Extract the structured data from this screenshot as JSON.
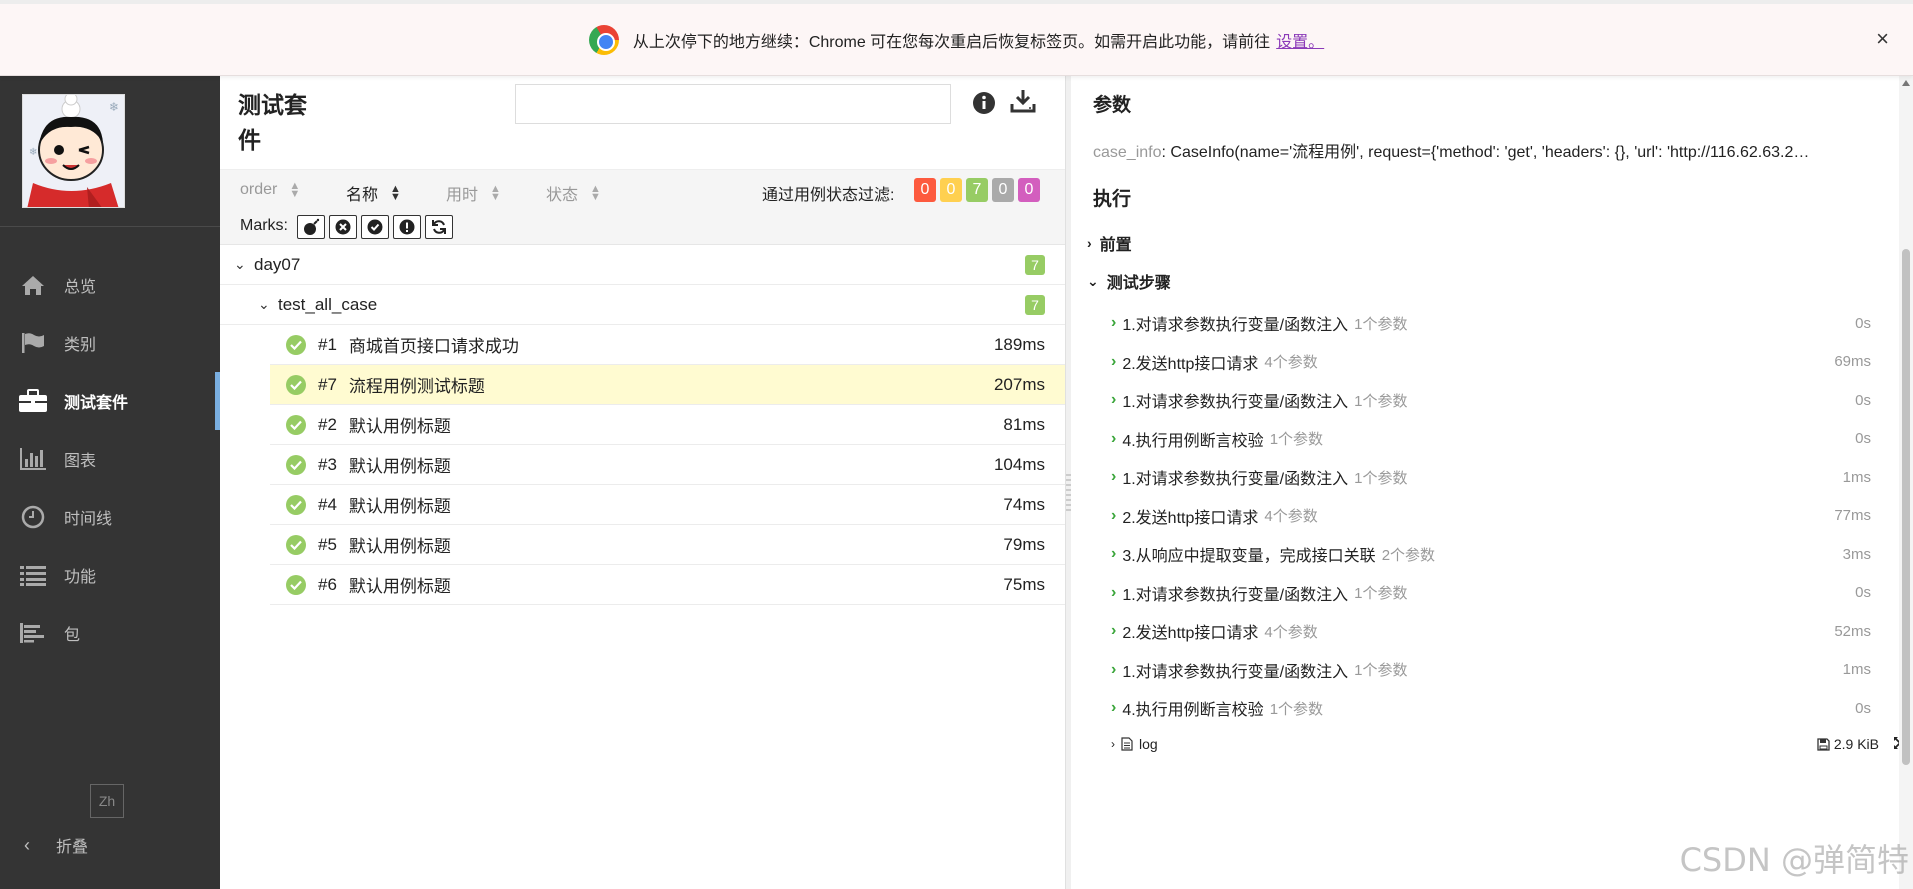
{
  "infobar": {
    "message": "从上次停下的地方继续：Chrome 可在您每次重启后恢复标签页。如需开启此功能，请前往",
    "link": "设置。",
    "close_label": "×"
  },
  "sidebar": {
    "items": [
      {
        "label": "总览",
        "icon": "home-icon"
      },
      {
        "label": "类别",
        "icon": "flag-icon"
      },
      {
        "label": "测试套件",
        "icon": "briefcase-icon",
        "active": true
      },
      {
        "label": "图表",
        "icon": "bar-chart-icon"
      },
      {
        "label": "时间线",
        "icon": "clock-icon"
      },
      {
        "label": "功能",
        "icon": "list-icon"
      },
      {
        "label": "包",
        "icon": "align-left-icon"
      }
    ],
    "lang": "Zh",
    "collapse": "折叠"
  },
  "suites": {
    "title": "测试套件",
    "search_placeholder": "",
    "sort": {
      "order": "order",
      "name": "名称",
      "duration": "用时",
      "status": "状态"
    },
    "filter_label": "通过用例状态过滤:",
    "filter_counts": [
      {
        "value": "0",
        "color": "#fd5a3e"
      },
      {
        "value": "0",
        "color": "#ffd050"
      },
      {
        "value": "7",
        "color": "#97cc64"
      },
      {
        "value": "0",
        "color": "#aaaaaa"
      },
      {
        "value": "0",
        "color": "#d35ebe"
      }
    ],
    "marks_label": "Marks:",
    "groups": [
      {
        "name": "day07",
        "count": "7"
      },
      {
        "name": "test_all_case",
        "count": "7"
      }
    ],
    "cases": [
      {
        "num": "#1",
        "title": "商城首页接口请求成功",
        "duration": "189ms"
      },
      {
        "num": "#7",
        "title": "流程用例测试标题",
        "duration": "207ms",
        "selected": true
      },
      {
        "num": "#2",
        "title": "默认用例标题",
        "duration": "81ms"
      },
      {
        "num": "#3",
        "title": "默认用例标题",
        "duration": "104ms"
      },
      {
        "num": "#4",
        "title": "默认用例标题",
        "duration": "74ms"
      },
      {
        "num": "#5",
        "title": "默认用例标题",
        "duration": "79ms"
      },
      {
        "num": "#6",
        "title": "默认用例标题",
        "duration": "75ms"
      }
    ]
  },
  "detail": {
    "params_heading": "参数",
    "param_key": "case_info",
    "param_value": ": CaseInfo(name='流程用例', request={'method': 'get', 'headers': {}, 'url': 'http://116.62.63.2…",
    "exec_heading": "执行",
    "setup_label": "前置",
    "steps_label": "测试步骤",
    "steps": [
      {
        "title": "1.对请求参数执行变量/函数注入",
        "params": "1个参数",
        "duration": "0s"
      },
      {
        "title": "2.发送http接口请求",
        "params": "4个参数",
        "duration": "69ms"
      },
      {
        "title": "1.对请求参数执行变量/函数注入",
        "params": "1个参数",
        "duration": "0s"
      },
      {
        "title": "4.执行用例断言校验",
        "params": "1个参数",
        "duration": "0s"
      },
      {
        "title": "1.对请求参数执行变量/函数注入",
        "params": "1个参数",
        "duration": "1ms"
      },
      {
        "title": "2.发送http接口请求",
        "params": "4个参数",
        "duration": "77ms"
      },
      {
        "title": "3.从响应中提取变量，完成接口关联",
        "params": "2个参数",
        "duration": "3ms"
      },
      {
        "title": "1.对请求参数执行变量/函数注入",
        "params": "1个参数",
        "duration": "0s"
      },
      {
        "title": "2.发送http接口请求",
        "params": "4个参数",
        "duration": "52ms"
      },
      {
        "title": "1.对请求参数执行变量/函数注入",
        "params": "1个参数",
        "duration": "1ms"
      },
      {
        "title": "4.执行用例断言校验",
        "params": "1个参数",
        "duration": "0s"
      }
    ],
    "log_label": "log",
    "log_size": "2.9 KiB"
  },
  "watermark": "CSDN @弹简特"
}
